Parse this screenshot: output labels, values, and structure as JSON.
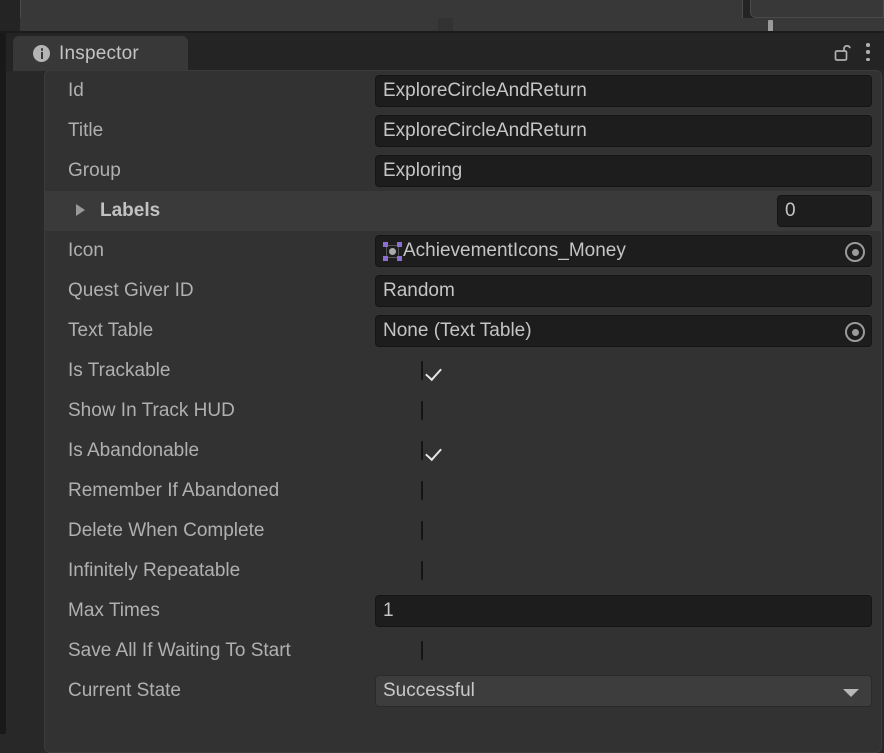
{
  "top_window": {
    "scroll_nub": ""
  },
  "inspector": {
    "tab_label": "Inspector",
    "info_icon": "info-icon",
    "lock_icon": "unlocked-padlock-icon",
    "menu_icon": "kebab-menu-icon",
    "rows": [
      {
        "label": "Id",
        "type": "text",
        "value": "ExploreCircleAndReturn"
      },
      {
        "label": "Title",
        "type": "text",
        "value": "ExploreCircleAndReturn"
      },
      {
        "label": "Group",
        "type": "text",
        "value": "Exploring"
      },
      {
        "label": "Labels",
        "type": "foldout",
        "value": "0",
        "expanded": false,
        "arrow_icon": "triangle-right-icon"
      },
      {
        "label": "Icon",
        "type": "object",
        "value": "AchievementIcons_Money",
        "thumb_icon": "sprite-thumbnail-icon",
        "picker_icon": "object-picker-icon"
      },
      {
        "label": "Quest Giver ID",
        "type": "text",
        "value": "Random"
      },
      {
        "label": "Text Table",
        "type": "object",
        "value": "None (Text Table)",
        "picker_icon": "object-picker-icon"
      },
      {
        "label": "Is Trackable",
        "type": "checkbox",
        "checked": true
      },
      {
        "label": "Show In Track HUD",
        "type": "checkbox",
        "checked": false
      },
      {
        "label": "Is Abandonable",
        "type": "checkbox",
        "checked": true
      },
      {
        "label": "Remember If Abandoned",
        "type": "checkbox",
        "checked": false
      },
      {
        "label": "Delete When Complete",
        "type": "checkbox",
        "checked": false
      },
      {
        "label": "Infinitely Repeatable",
        "type": "checkbox",
        "checked": false
      },
      {
        "label": "Max Times",
        "type": "text",
        "value": "1"
      },
      {
        "label": "Save All If Waiting To Start",
        "type": "checkbox",
        "checked": false
      },
      {
        "label": "Current State",
        "type": "dropdown",
        "value": "Successful",
        "caret_icon": "chevron-down-icon"
      }
    ]
  },
  "colors": {
    "window_bg": "#282828",
    "panel_bg": "#323232",
    "tab_bg": "#383838",
    "field_bg": "#1d1d1d",
    "dropdown_bg": "#3d3d3d",
    "label_text": "#b0b0b0",
    "value_text": "#c5c5c5",
    "sprite_handle": "#8b6fd4"
  }
}
